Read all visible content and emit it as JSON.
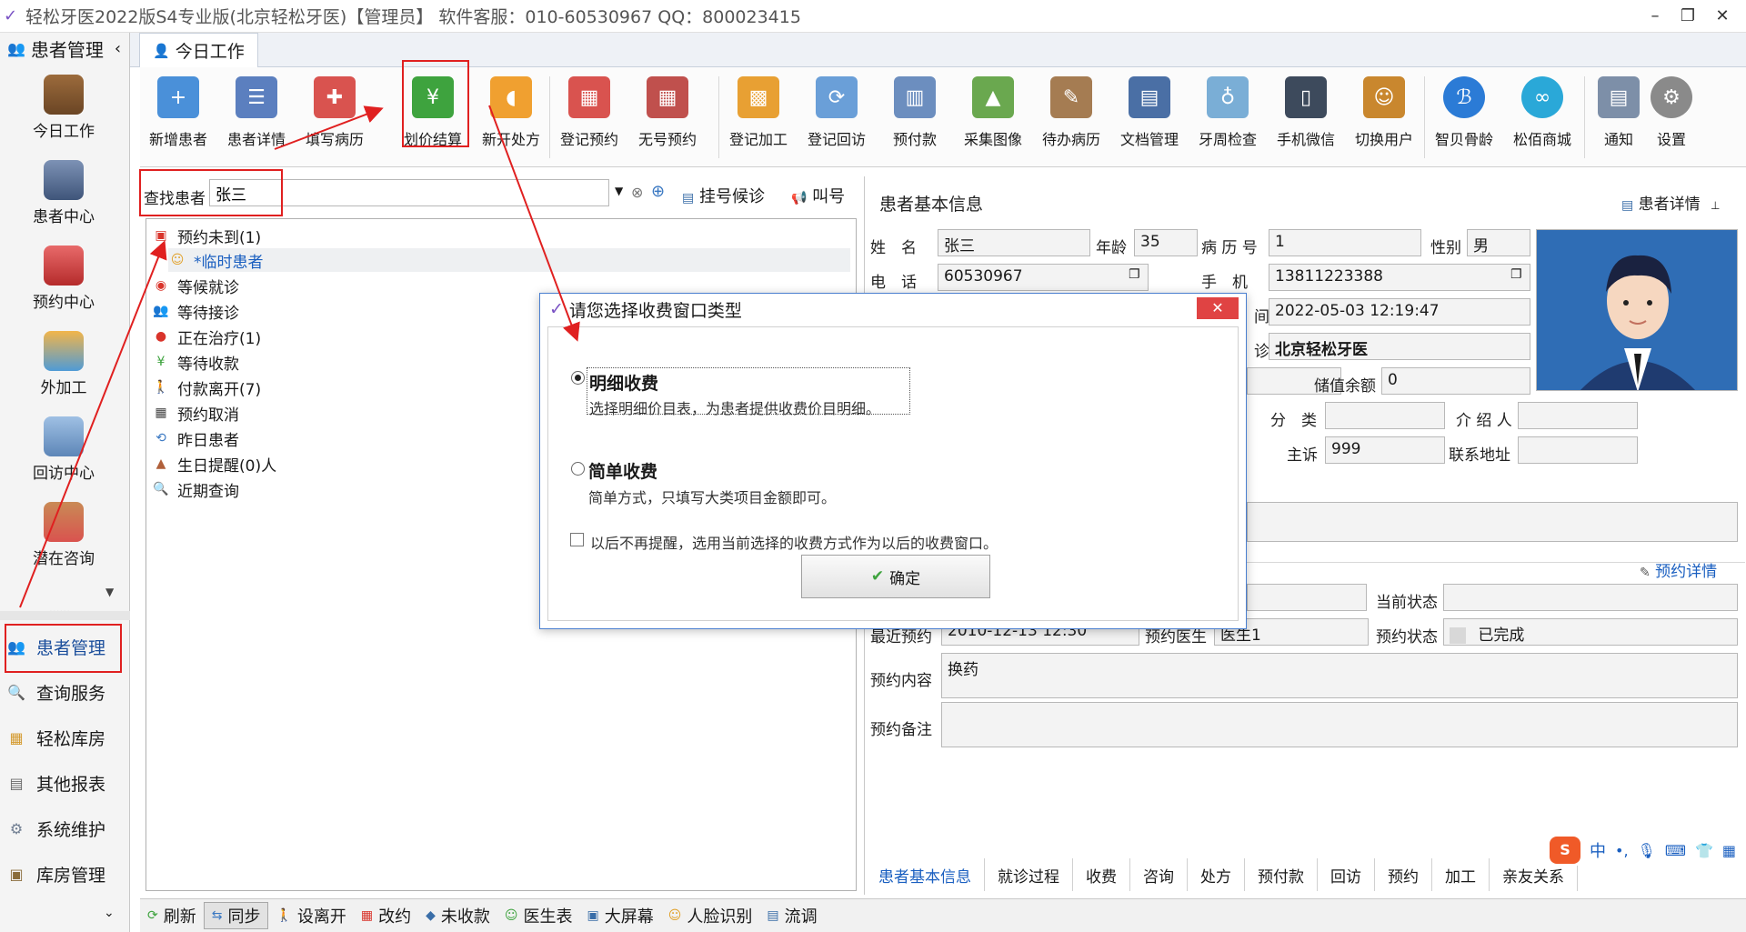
{
  "window": {
    "title": "轻松牙医2022版S4专业版(北京轻松牙医)【管理员】    软件客服：010-60530967 QQ：800023415"
  },
  "sidebar": {
    "header": "患者管理",
    "tiles": [
      {
        "label": "今日工作"
      },
      {
        "label": "患者中心"
      },
      {
        "label": "预约中心"
      },
      {
        "label": "外加工"
      },
      {
        "label": "回访中心"
      },
      {
        "label": "潜在咨询"
      }
    ],
    "links": [
      {
        "label": "患者管理"
      },
      {
        "label": "查询服务"
      },
      {
        "label": "轻松库房"
      },
      {
        "label": "其他报表"
      },
      {
        "label": "系统维护"
      },
      {
        "label": "库房管理"
      }
    ]
  },
  "tabs": {
    "today": "今日工作"
  },
  "ribbon": {
    "tools": [
      {
        "label": "新增患者",
        "color": "#4a90d9"
      },
      {
        "label": "患者详情",
        "color": "#5b7fbf"
      },
      {
        "label": "填写病历",
        "color": "#d9534f"
      },
      {
        "label": "划价结算",
        "color": "#3ea33e"
      },
      {
        "label": "新开处方",
        "color": "#f0a030"
      },
      {
        "label": "登记预约",
        "color": "#d9534f"
      },
      {
        "label": "无号预约",
        "color": "#c0504d"
      },
      {
        "label": "登记加工",
        "color": "#e8a033"
      },
      {
        "label": "登记回访",
        "color": "#6a9fd8"
      },
      {
        "label": "预付款",
        "color": "#6c8ebf"
      },
      {
        "label": "采集图像",
        "color": "#6aa84f"
      },
      {
        "label": "待办病历",
        "color": "#a57c52"
      },
      {
        "label": "文档管理",
        "color": "#4a6fa5"
      },
      {
        "label": "牙周检查",
        "color": "#7aaed6"
      },
      {
        "label": "手机微信",
        "color": "#3d4a5c"
      },
      {
        "label": "切换用户",
        "color": "#c9872e"
      },
      {
        "label": "智贝骨龄",
        "color": "#2b7bd6"
      },
      {
        "label": "松佰商城",
        "color": "#2aa8d8"
      },
      {
        "label": "通知",
        "color": "#7d8fa8"
      },
      {
        "label": "设置",
        "color": "#8a8a8a"
      }
    ]
  },
  "search": {
    "label": "查找患者",
    "value": "张三",
    "queue_button": "挂号候诊",
    "call_button": "叫号"
  },
  "tree": {
    "nodes": [
      {
        "label": "预约未到(1)"
      },
      {
        "label": "*临时患者"
      },
      {
        "label": "等候就诊"
      },
      {
        "label": "等待接诊"
      },
      {
        "label": "正在治疗(1)"
      },
      {
        "label": "等待收款"
      },
      {
        "label": "付款离开(7)"
      },
      {
        "label": "预约取消"
      },
      {
        "label": "昨日患者"
      },
      {
        "label": "生日提醒(0)人"
      },
      {
        "label": "近期查询"
      }
    ]
  },
  "patient": {
    "section_title": "患者基本信息",
    "detail_link": "患者详情",
    "name_label": "姓　名",
    "name": "张三",
    "age_label": "年龄",
    "age": "35",
    "record_label": "病 历 号",
    "record": "1",
    "gender_label": "性别",
    "gender": "男",
    "phone_label": "电　话",
    "phone": "60530967",
    "mobile_label": "手　机",
    "mobile": "13811223388",
    "time_label_tail": "间",
    "time": "2022-05-03 12:19:47",
    "clinic_label_tail": "诊",
    "clinic": "北京轻松牙医",
    "balance_label": "储值余额",
    "balance": "0",
    "category_label": "分　类",
    "category": "",
    "referrer_label": "介 绍 人",
    "referrer": "",
    "complaint_label": "主诉",
    "complaint": "999",
    "address_label": "联系地址",
    "address": ""
  },
  "appointment": {
    "detail_link": "预约详情",
    "current_status_label": "当前状态",
    "current_status": "",
    "recent_label": "最近预约",
    "recent": "2010-12-13 12:30",
    "doctor_label": "预约医生",
    "doctor": "医生1",
    "status_label": "预约状态",
    "status": "已完成",
    "content_label": "预约内容",
    "content": "换药",
    "note_label": "预约备注",
    "note": ""
  },
  "right_tabs": [
    "患者基本信息",
    "就诊过程",
    "收费",
    "咨询",
    "处方",
    "预付款",
    "回访",
    "预约",
    "加工",
    "亲友关系"
  ],
  "bottom_bar": [
    {
      "label": "刷新"
    },
    {
      "label": "同步"
    },
    {
      "label": "设离开"
    },
    {
      "label": "改约"
    },
    {
      "label": "未收款"
    },
    {
      "label": "医生表"
    },
    {
      "label": "大屏幕"
    },
    {
      "label": "人脸识别"
    },
    {
      "label": "流调"
    }
  ],
  "dialog": {
    "title": "请您选择收费窗口类型",
    "close": "✕",
    "option1_title": "明细收费",
    "option1_desc": "选择明细价目表，为患者提供收费价目明细。",
    "option2_title": "简单收费",
    "option2_desc": "简单方式，只填写大类项目金额即可。",
    "remember": "以后不再提醒，选用当前选择的收费方式作为以后的收费窗口。",
    "ok": "确定"
  },
  "ime": {
    "label": "中"
  }
}
